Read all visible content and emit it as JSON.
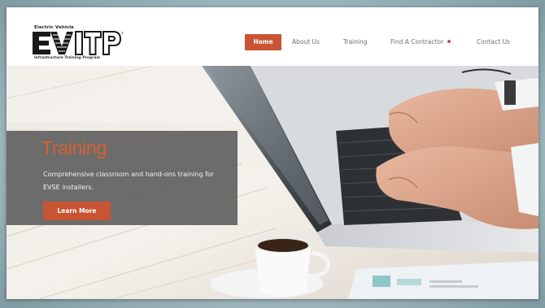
{
  "logo": {
    "top_text": "Electric Vehicle",
    "mark_text": "EVITP",
    "trademark": "TM",
    "bottom_text": "Infrastructure Training Program"
  },
  "nav": {
    "items": [
      {
        "label": "Home",
        "active": true
      },
      {
        "label": "About Us"
      },
      {
        "label": "Training"
      },
      {
        "label": "Find A Contractor"
      },
      {
        "label": "Contact Us"
      }
    ]
  },
  "hero": {
    "title": "Training",
    "text": "Comprehensive classroom and hand-ons training for EVSE installers.",
    "button_label": "Learn More"
  },
  "colors": {
    "accent": "#c85434",
    "overlay": "#5a5a5a",
    "title": "#d7622f"
  }
}
